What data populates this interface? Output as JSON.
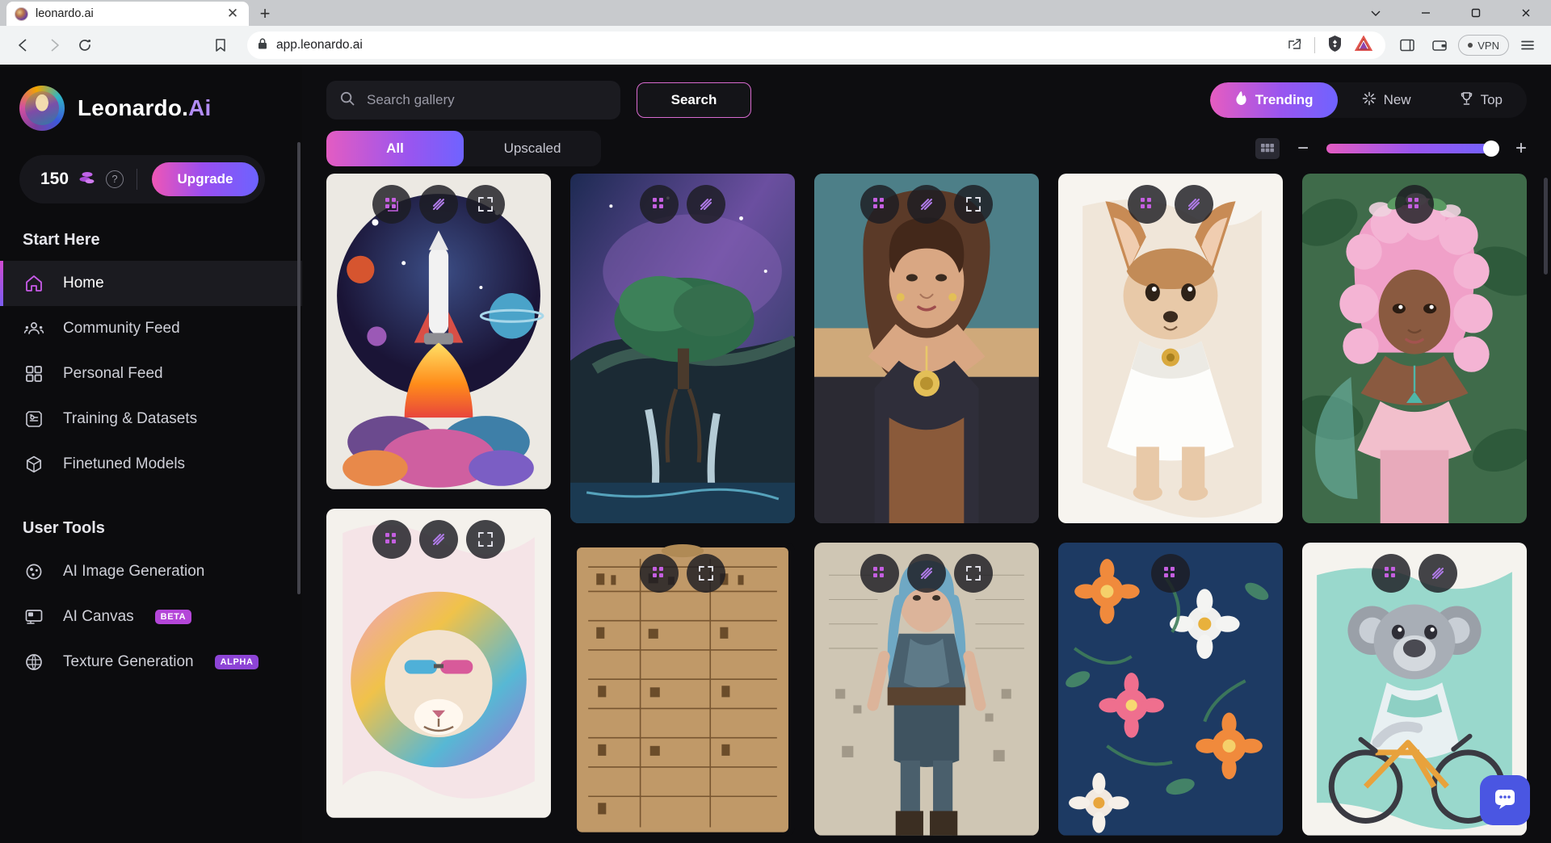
{
  "browser": {
    "tab": {
      "title": "leonardo.ai",
      "favicon_icon": "leonardo-favicon",
      "close_icon": "close-icon"
    },
    "new_tab_icon": "plus-icon",
    "window_controls": {
      "minimize_icon": "minimize-icon",
      "maximize_icon": "maximize-icon",
      "close_icon": "window-close-icon",
      "chevron_icon": "chevron-down-icon"
    },
    "nav": {
      "back_icon": "back-arrow-icon",
      "forward_icon": "forward-arrow-icon",
      "reload_icon": "reload-icon",
      "bookmark_icon": "bookmark-icon",
      "lock_icon": "lock-icon",
      "url": "app.leonardo.ai",
      "share_icon": "share-icon",
      "brave_icon": "brave-lion-icon",
      "rewards_icon": "brave-rewards-triangle-icon",
      "sidebar_icon": "sidebar-panel-icon",
      "wallet_icon": "wallet-icon",
      "vpn_label": "VPN",
      "menu_icon": "hamburger-menu-icon"
    }
  },
  "sidebar": {
    "brand": {
      "name": "Leonardo.",
      "suffix": "Ai",
      "logo_icon": "leonardo-logo-icon"
    },
    "credits": {
      "amount": "150",
      "coin_icon": "coin-stack-icon",
      "help_icon": "help-circle-icon",
      "upgrade_label": "Upgrade"
    },
    "sections": [
      {
        "title": "Start Here",
        "items": [
          {
            "label": "Home",
            "icon": "home-icon",
            "active": true
          },
          {
            "label": "Community Feed",
            "icon": "community-people-icon",
            "active": false
          },
          {
            "label": "Personal Feed",
            "icon": "grid-squares-icon",
            "active": false
          },
          {
            "label": "Training & Datasets",
            "icon": "training-datasets-icon",
            "active": false
          },
          {
            "label": "Finetuned Models",
            "icon": "cube-icon",
            "active": false
          }
        ]
      },
      {
        "title": "User Tools",
        "items": [
          {
            "label": "AI Image Generation",
            "icon": "ai-image-generation-icon",
            "active": false,
            "badge": ""
          },
          {
            "label": "AI Canvas",
            "icon": "ai-canvas-icon",
            "active": false,
            "badge": "BETA"
          },
          {
            "label": "Texture Generation",
            "icon": "texture-generation-icon",
            "active": false,
            "badge": "ALPHA"
          }
        ]
      }
    ]
  },
  "main": {
    "search": {
      "placeholder": "Search gallery",
      "value": "",
      "icon": "search-icon",
      "button_label": "Search"
    },
    "sort_tabs": [
      {
        "label": "Trending",
        "icon": "flame-icon",
        "active": true
      },
      {
        "label": "New",
        "icon": "sparkle-icon",
        "active": false
      },
      {
        "label": "Top",
        "icon": "trophy-icon",
        "active": false
      }
    ],
    "filter_tabs": [
      {
        "label": "All",
        "active": true
      },
      {
        "label": "Upscaled",
        "active": false
      }
    ],
    "zoom_controls": {
      "grid_icon": "grid-layout-icon",
      "minus_label": "−",
      "plus_label": "+",
      "slider_value": "100"
    },
    "card_overlay_actions": [
      {
        "icon": "copy-prompt-icon"
      },
      {
        "icon": "remix-icon"
      },
      {
        "icon": "fullscreen-expand-icon"
      }
    ],
    "gallery_items": [
      {
        "alt": "Colorful illustration of a space shuttle launching among planets",
        "actions": 3
      },
      {
        "alt": "Fantasy tree on a cliff above waterfalls under a starry nebula sky",
        "actions": 2
      },
      {
        "alt": "Portrait of a woman with long brown hair and gold necklace",
        "actions": 3
      },
      {
        "alt": "Watercolor chihuahua dog wearing a white bandana",
        "actions": 2
      },
      {
        "alt": "Fairy girl with pink curly hair and flower crown",
        "actions": 1
      },
      {
        "alt": "Colorful watercolor lion wearing sunglasses",
        "actions": 3
      },
      {
        "alt": "Ancient Egyptian papyrus scroll with hieroglyphs",
        "actions": 2
      },
      {
        "alt": "Blue haired warrior woman in leather armor",
        "actions": 3
      },
      {
        "alt": "Floral pattern with orange and pink flowers on dark blue",
        "actions": 1
      },
      {
        "alt": "Cartoon koala riding a bicycle",
        "actions": 2
      }
    ],
    "chat_fab_icon": "intercom-chat-icon"
  }
}
